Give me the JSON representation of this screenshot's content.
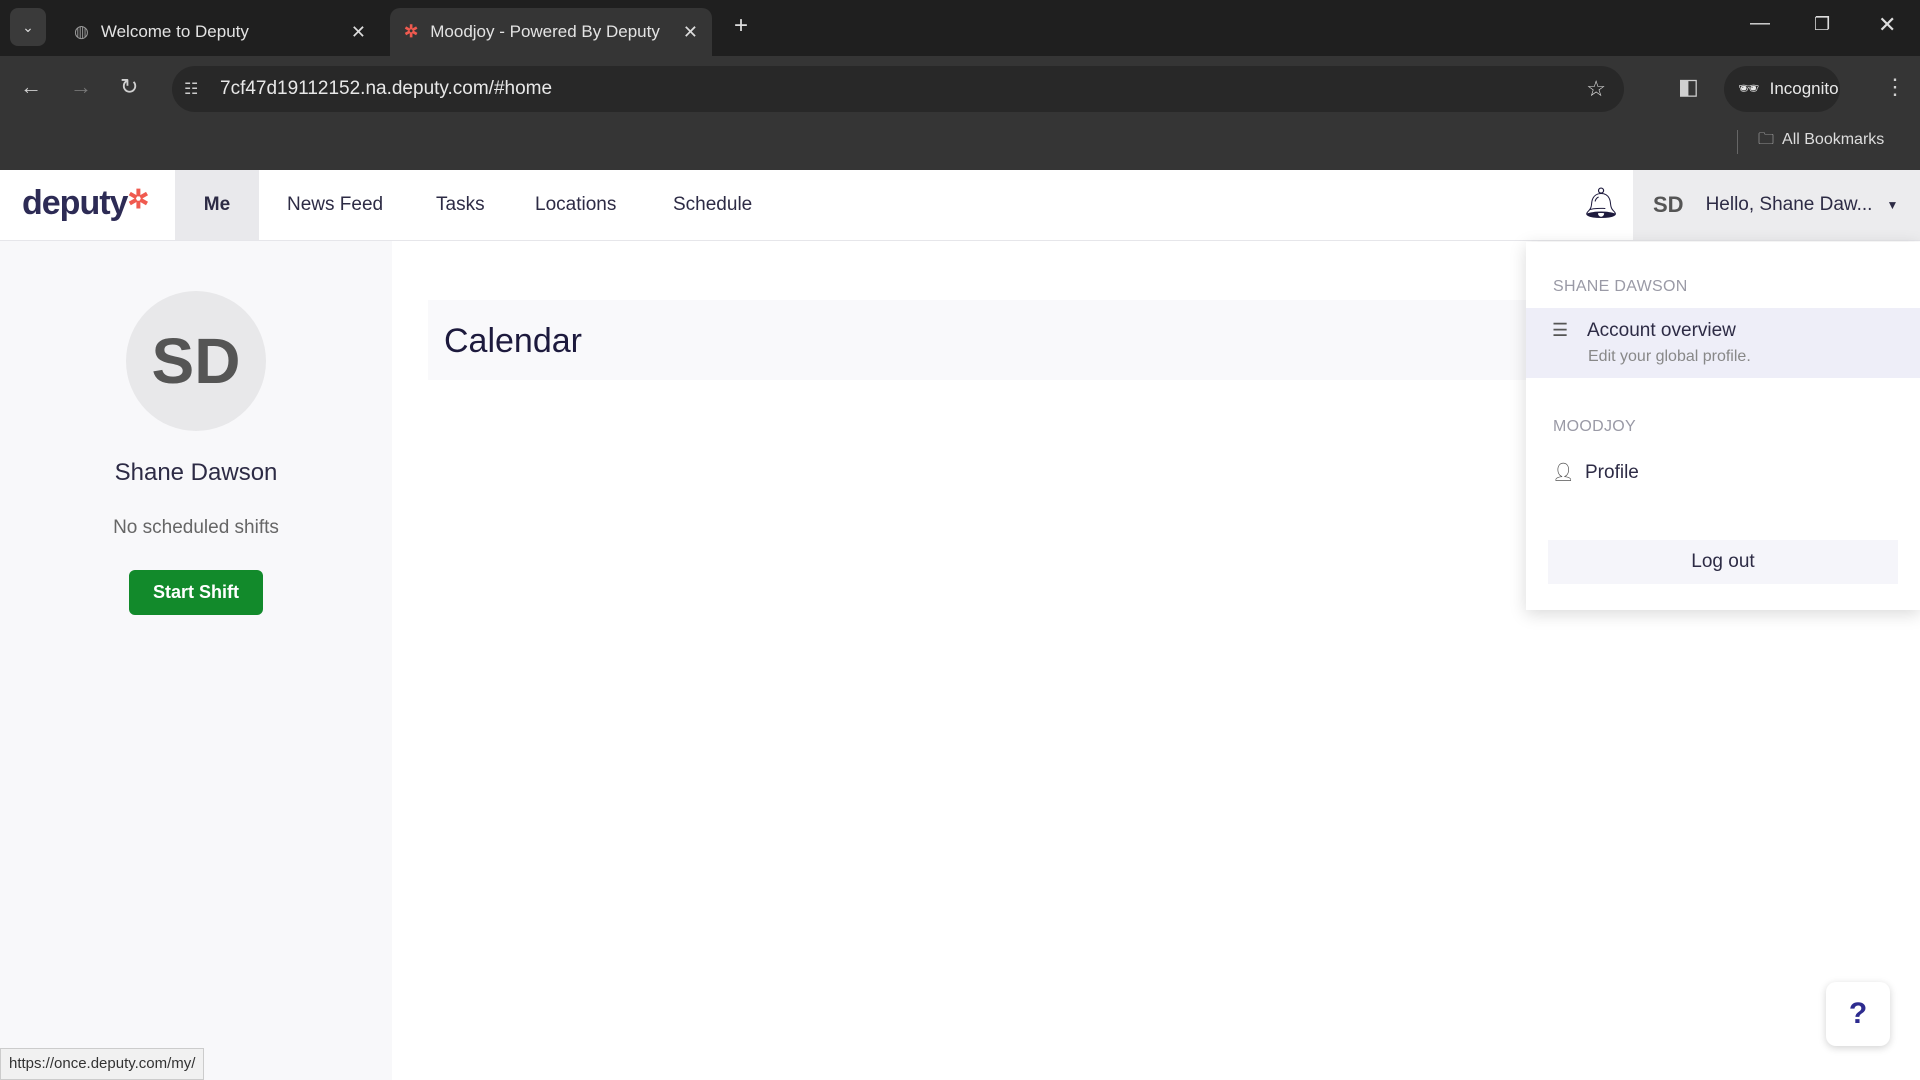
{
  "browser": {
    "tabs": [
      {
        "title": "Welcome to Deputy",
        "active": false
      },
      {
        "title": "Moodjoy - Powered By Deputy",
        "active": true
      }
    ],
    "url": "7cf47d19112152.na.deputy.com/#home",
    "incognito_label": "Incognito",
    "bookmarks_label": "All Bookmarks",
    "status_url": "https://once.deputy.com/my/"
  },
  "header": {
    "logo": "deputy",
    "nav": [
      "Me",
      "News Feed",
      "Tasks",
      "Locations",
      "Schedule"
    ],
    "active_nav": "Me",
    "user_initials": "SD",
    "greeting": "Hello, Shane Daw..."
  },
  "sidebar": {
    "avatar_initials": "SD",
    "name": "Shane Dawson",
    "shift_status": "No scheduled shifts",
    "start_shift_label": "Start Shift"
  },
  "main": {
    "calendar_title": "Calendar"
  },
  "menu": {
    "section1": "SHANE DAWSON",
    "account_title": "Account overview",
    "account_sub": "Edit your global profile.",
    "section2": "MOODJOY",
    "profile_label": "Profile",
    "logout_label": "Log out"
  },
  "help": {
    "label": "?"
  },
  "colors": {
    "brand": "#2d2b55",
    "accent": "#f05a4f",
    "start_shift": "#128a2b"
  }
}
